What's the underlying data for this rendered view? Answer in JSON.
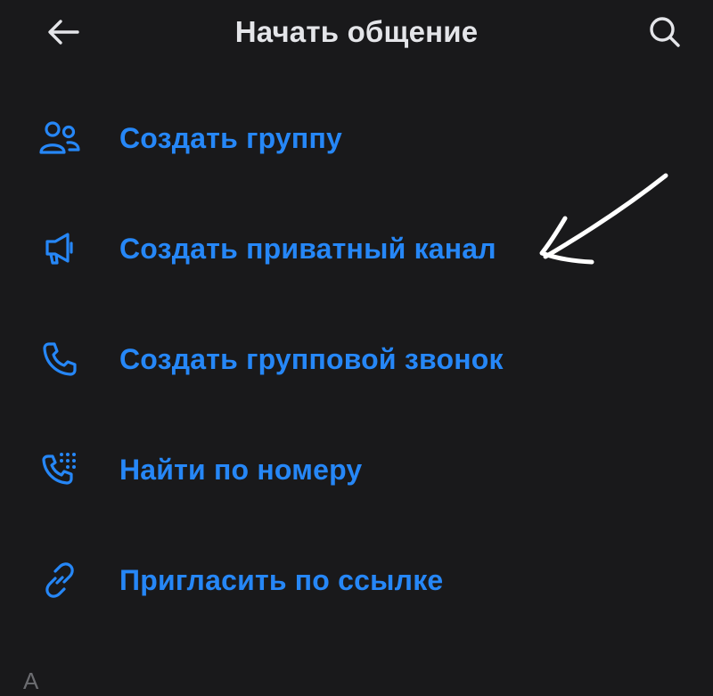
{
  "header": {
    "title": "Начать общение",
    "back_icon": "arrow-left-icon",
    "search_icon": "search-icon"
  },
  "menu": {
    "items": [
      {
        "label": "Создать группу",
        "icon": "group-users-icon"
      },
      {
        "label": "Создать приватный канал",
        "icon": "megaphone-icon"
      },
      {
        "label": "Создать групповой звонок",
        "icon": "phone-icon"
      },
      {
        "label": "Найти по номеру",
        "icon": "dialpad-phone-icon"
      },
      {
        "label": "Пригласить по ссылке",
        "icon": "link-icon"
      }
    ]
  },
  "section": {
    "letter": "A"
  },
  "colors": {
    "background": "#19191b",
    "accent": "#2687f7",
    "title_text": "#e4e5e9",
    "muted_text": "#6b6c70",
    "annotation": "#ffffff"
  }
}
